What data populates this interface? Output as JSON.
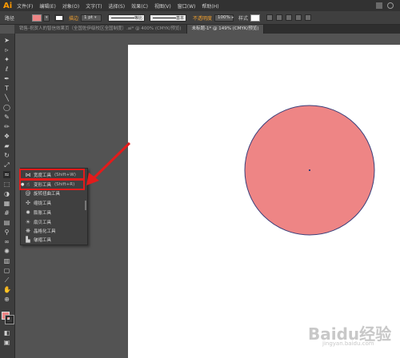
{
  "app": {
    "logo": "Ai",
    "menu": [
      "文件(F)",
      "编辑(E)",
      "对象(O)",
      "文字(T)",
      "选择(S)",
      "效果(C)",
      "视图(V)",
      "窗口(W)",
      "帮助(H)"
    ]
  },
  "control": {
    "object_label": "路径",
    "stroke_label": "描边",
    "stroke_weight": "1 pt",
    "profile_label": "等比",
    "brush_label": "基本",
    "opacity_label": "不透明度",
    "opacity_value": "100%",
    "style_label": "样式"
  },
  "tabs": [
    {
      "label": "销售-祝贺人的智信效果页（全国佐伊级校区全国制度）.ai* @ 400% (CMYK/预览)"
    },
    {
      "label": "未标题-1* @ 149% (CMYK/预览)"
    }
  ],
  "flyout": {
    "items": [
      {
        "label": "宽度工具",
        "shortcut": "(Shift+W)",
        "icon": "width-tool-icon"
      },
      {
        "label": "变形工具",
        "shortcut": "(Shift+R)",
        "icon": "warp-tool-icon",
        "selected": true
      },
      {
        "label": "旋转扭曲工具",
        "shortcut": "",
        "icon": "twirl-tool-icon"
      },
      {
        "label": "缩拢工具",
        "shortcut": "",
        "icon": "pucker-tool-icon"
      },
      {
        "label": "膨胀工具",
        "shortcut": "",
        "icon": "bloat-tool-icon"
      },
      {
        "label": "扇贝工具",
        "shortcut": "",
        "icon": "scallop-tool-icon"
      },
      {
        "label": "晶格化工具",
        "shortcut": "",
        "icon": "crystallize-tool-icon"
      },
      {
        "label": "皱褶工具",
        "shortcut": "",
        "icon": "wrinkle-tool-icon"
      }
    ]
  },
  "canvas": {
    "circle_fill": "#ee8585",
    "circle_stroke": "#3b3f7a",
    "highlight_color": "#e31b1b"
  },
  "watermark": {
    "text": "Baidu经验",
    "sub": "jingyan.baidu.com"
  }
}
